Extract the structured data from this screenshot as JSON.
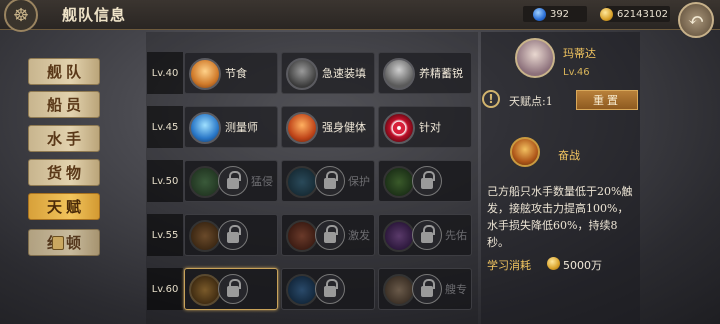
{
  "header": {
    "title": "舰队信息",
    "gems": "392",
    "gold": "62143102"
  },
  "tabs": [
    {
      "label": "舰队"
    },
    {
      "label": "船员"
    },
    {
      "label": "水手"
    },
    {
      "label": "货物"
    },
    {
      "label": "天赋"
    },
    {
      "label": "纪顿"
    }
  ],
  "rows": [
    {
      "level": "Lv.40",
      "skills": [
        {
          "name": "节食"
        },
        {
          "name": "急速装填"
        },
        {
          "name": "养精蓄锐"
        }
      ]
    },
    {
      "level": "Lv.45",
      "skills": [
        {
          "name": "测量师"
        },
        {
          "name": "强身健体"
        },
        {
          "name": "针对"
        }
      ]
    },
    {
      "level": "Lv.50",
      "skills": [
        {
          "name": "猛侵"
        },
        {
          "name": "保护"
        },
        {
          "name": ""
        }
      ]
    },
    {
      "level": "Lv.55",
      "skills": [
        {
          "name": ""
        },
        {
          "name": "激发"
        },
        {
          "name": "先佑"
        }
      ]
    },
    {
      "level": "Lv.60",
      "skills": [
        {
          "name": ""
        },
        {
          "name": ""
        },
        {
          "name": "艘专"
        }
      ]
    }
  ],
  "captain": {
    "name": "玛蒂达",
    "level": "Lv.46"
  },
  "talent_points": "天赋点:1",
  "reset_label": "重置",
  "selected": {
    "name": "奋战",
    "description": "己方船只水手数量低于20%触发，接舷攻击力提高100%，水手损失降低60%，持续8秒。",
    "learn_label": "学习消耗",
    "cost": "5000万"
  }
}
